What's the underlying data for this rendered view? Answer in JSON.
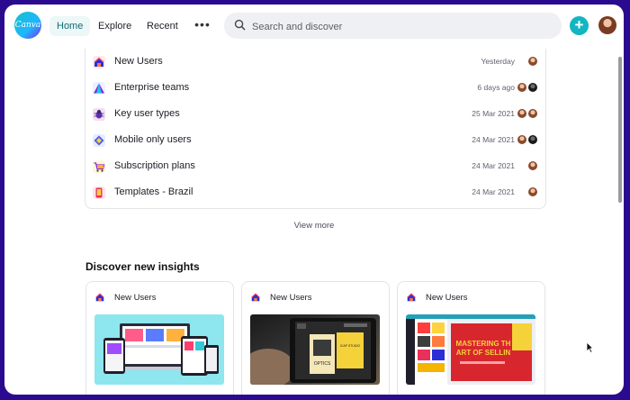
{
  "header": {
    "nav": [
      {
        "label": "Home"
      },
      {
        "label": "Explore"
      },
      {
        "label": "Recent"
      }
    ],
    "more_label": "•••",
    "search_placeholder": "Search and discover",
    "logo_text": "Canva"
  },
  "recent_list": [
    {
      "name": "New Users",
      "date": "Yesterday",
      "icon": "house-icon"
    },
    {
      "name": "Enterprise teams",
      "date": "6 days ago",
      "icon": "triangle-icon"
    },
    {
      "name": "Key user types",
      "date": "25 Mar 2021",
      "icon": "bug-icon"
    },
    {
      "name": "Mobile only users",
      "date": "24 Mar 2021",
      "icon": "diamond-icon"
    },
    {
      "name": "Subscription plans",
      "date": "24 Mar 2021",
      "icon": "cart-icon"
    },
    {
      "name": "Templates - Brazil",
      "date": "24 Mar 2021",
      "icon": "phone-icon"
    }
  ],
  "view_more": "View more",
  "insights": {
    "heading": "Discover new insights",
    "cards": [
      {
        "title": "New Users",
        "thumb": "devices"
      },
      {
        "title": "New Users",
        "thumb": "tablet"
      },
      {
        "title": "New Users",
        "thumb": "editor"
      }
    ],
    "thumb_text": {
      "tablet_title": "OPTICS",
      "tablet_sub": "ICAP STUDIO",
      "editor_line1": "MASTERING TH",
      "editor_line2": "ART OF SELLIN"
    }
  }
}
